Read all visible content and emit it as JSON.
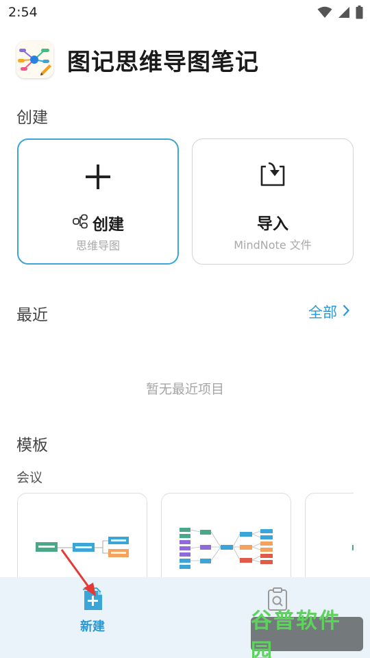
{
  "status_bar": {
    "time": "2:54",
    "icons": [
      "wifi-icon",
      "signal-icon",
      "battery-icon"
    ]
  },
  "app": {
    "title": "图记思维导图笔记",
    "logo_icon": "mindmap-logo-icon"
  },
  "create_section": {
    "title": "创建",
    "create_card": {
      "icon": "plus-icon",
      "label_icon": "mindmap-node-icon",
      "label": "创建",
      "sublabel": "思维导图"
    },
    "import_card": {
      "icon": "import-icon",
      "label": "导入",
      "sublabel": "MindNote 文件"
    }
  },
  "recent_section": {
    "title": "最近",
    "see_all": "全部",
    "empty_text": "暂无最近项目"
  },
  "template_section": {
    "title": "模板",
    "category": "会议",
    "templates": [
      {
        "preview": "meeting-mindmap-preview-1"
      },
      {
        "preview": "meeting-mindmap-preview-2"
      },
      {
        "preview": "meeting-mindmap-preview-3"
      }
    ]
  },
  "bottom_nav": {
    "items": [
      {
        "label": "新建",
        "icon": "new-doc-icon",
        "active": true
      },
      {
        "label": "",
        "icon": "history-clipboard-icon",
        "active": false
      }
    ]
  },
  "watermark": {
    "text": "谷普软件园"
  },
  "colors": {
    "accent": "#2a98d6",
    "card_border_active": "#3aa5d6",
    "nav_bg": "#e9f3f9",
    "arrow": "#e53935"
  }
}
